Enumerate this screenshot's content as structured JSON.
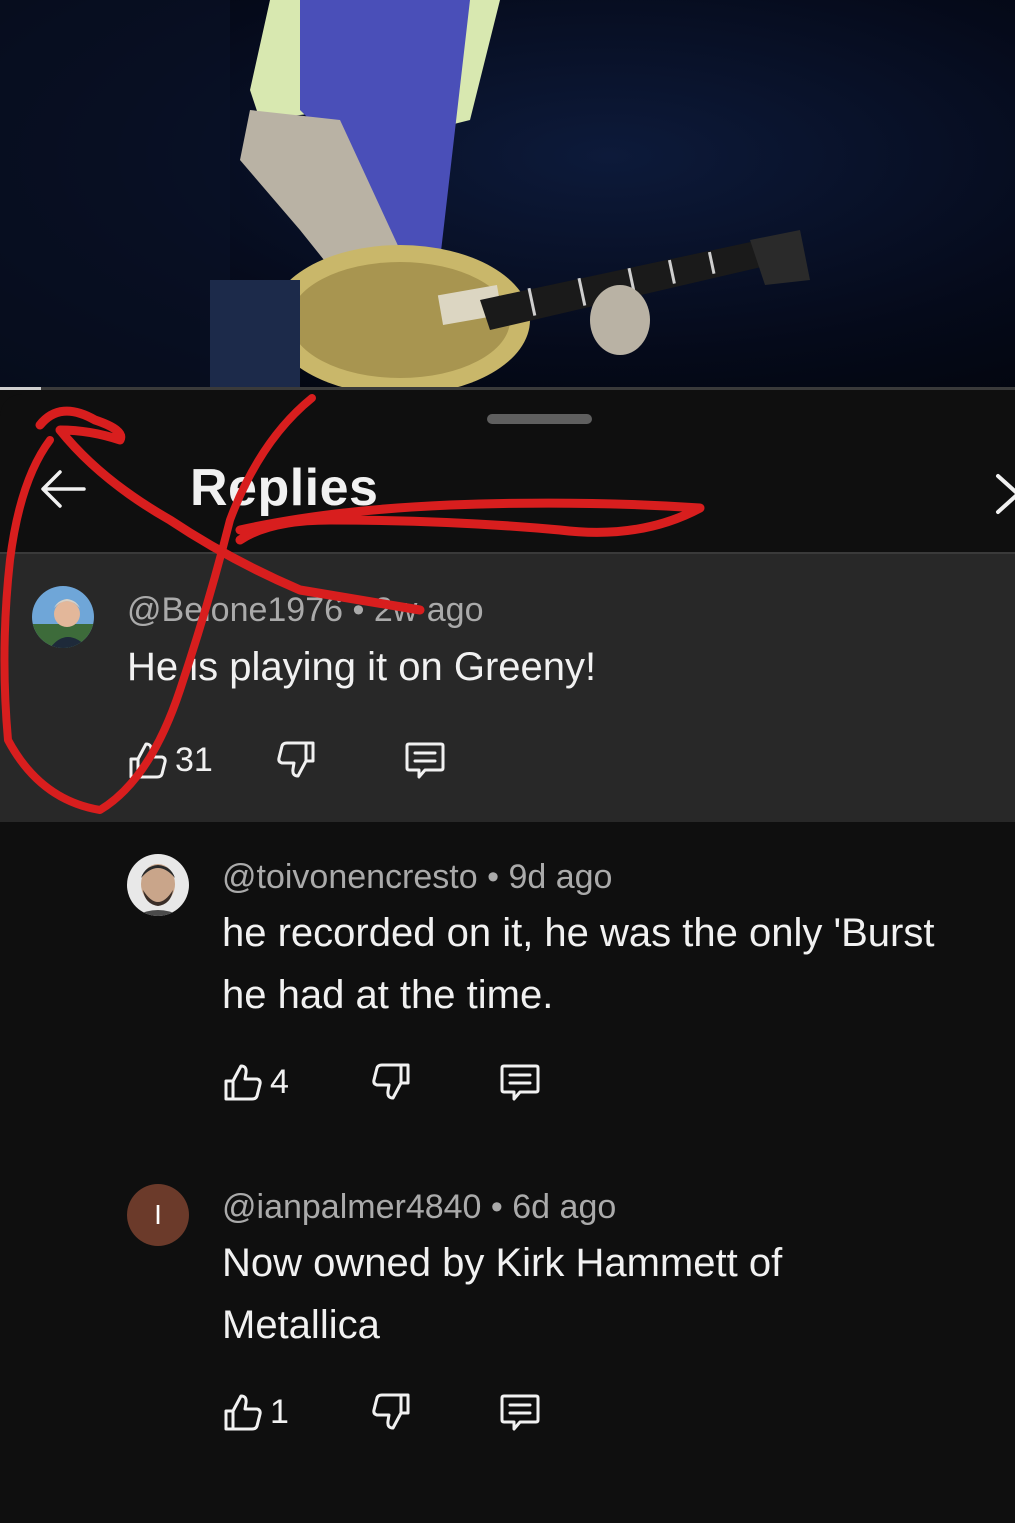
{
  "player": {
    "progress": 0.04
  },
  "sheet": {
    "title": "Replies",
    "colors": {
      "background": "#0f0f0f",
      "highlight": "#282828",
      "muted_text": "#aaaaaa",
      "annotation": "#d81e1e"
    }
  },
  "comments": [
    {
      "handle": "@Belone1976",
      "separator": "•",
      "time": "2w ago",
      "text": "He is playing it on Greeny!",
      "likes": "31",
      "avatar": "photo"
    },
    {
      "handle": "@toivonencresto",
      "separator": "•",
      "time": "9d ago",
      "text_lines": [
        "he recorded on it, he was the only 'Burst",
        "he had at the time."
      ],
      "likes": "4",
      "avatar": "photo"
    },
    {
      "handle": "@ianpalmer4840",
      "separator": "•",
      "time": "6d ago",
      "text_lines": [
        "Now owned by Kirk Hammett of",
        "Metallica"
      ],
      "likes": "1",
      "avatar_letter": "I",
      "avatar_color": "#6b3a2a"
    }
  ]
}
